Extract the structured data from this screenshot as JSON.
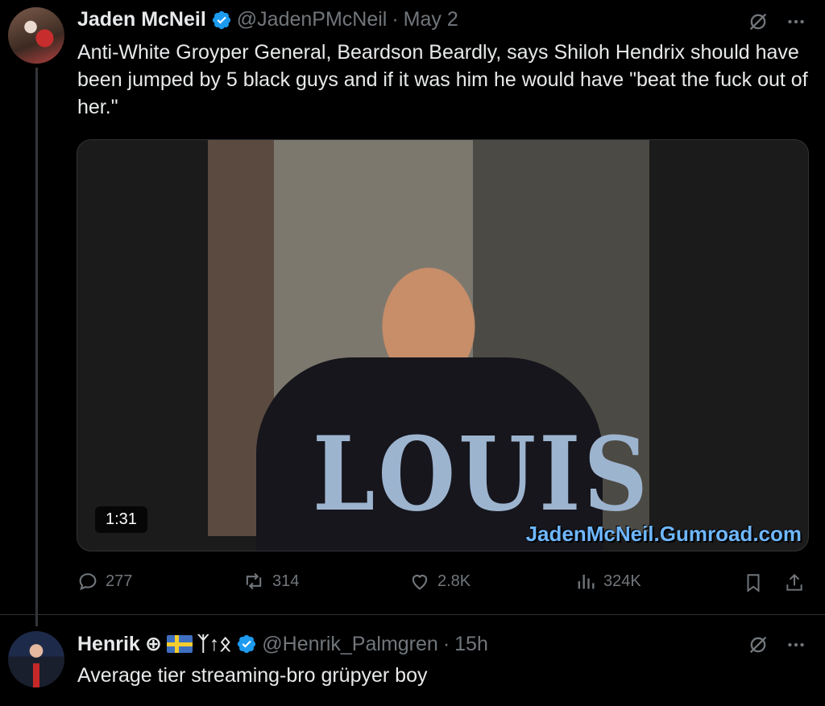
{
  "tweet": {
    "author_name": "Jaden McNeil",
    "author_handle": "@JadenPMcNeil",
    "separator": "·",
    "timestamp": "May 2",
    "text": "Anti-White Groyper General, Beardson Beardly, says Shiloh Hendrix should have been jumped by 5 black guys and if it was him he would have \"beat the fuck out of her.\"",
    "media": {
      "duration": "1:31",
      "shirt_text": "LOUIS",
      "watermark": "JadenMcNeil.Gumroad.com"
    },
    "stats": {
      "replies": "277",
      "reposts": "314",
      "likes": "2.8K",
      "views": "324K"
    }
  },
  "reply": {
    "author_name": "Henrik",
    "name_symbols": "⊕",
    "runes": "ᛉ↑ᛟ",
    "author_handle": "@Henrik_Palmgren",
    "separator": "·",
    "timestamp": "15h",
    "text": "Average tier streaming-bro grüpyer boy"
  },
  "icons": {
    "more": "more-icon",
    "grok": "grok-icon",
    "reply": "reply-icon",
    "repost": "repost-icon",
    "like": "like-icon",
    "views": "views-icon",
    "bookmark": "bookmark-icon",
    "share": "share-icon",
    "verified": "verified-badge-icon"
  },
  "colors": {
    "background": "#000000",
    "text": "#e7e9ea",
    "muted": "#71767b",
    "verified": "#1d9bf0",
    "watermark": "#6fb7ff"
  }
}
